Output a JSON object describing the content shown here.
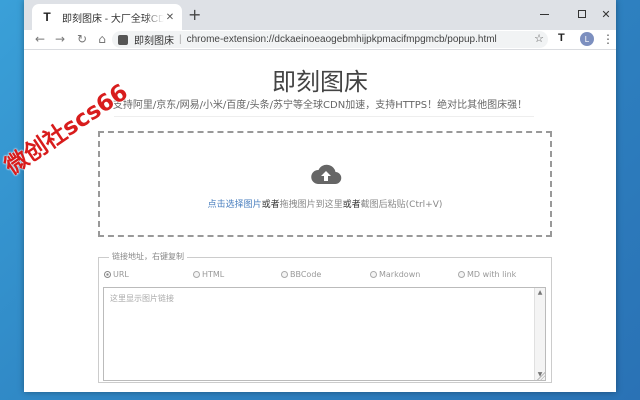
{
  "browser": {
    "tab_favicon": "T",
    "tab_title": "即刻图床 - 大厂全球CDN加速",
    "tab_close": "✕",
    "new_tab": "+",
    "window_controls": {
      "close": "✕"
    },
    "nav": {
      "back": "←",
      "forward": "→",
      "reload": "↻",
      "home": "⌂"
    },
    "omnibox": {
      "site": "即刻图床",
      "separator": "|",
      "url": "chrome-extension://dckaeinoeaogebmhijpkpmacifmpgmcb/popup.html",
      "star": "☆"
    },
    "toolbar_ext": "T",
    "profile_initial": "L",
    "menu": "⋮"
  },
  "page": {
    "title": "即刻图床",
    "subtitle": "支持阿里/京东/网易/小米/百度/头条/苏宁等全球CDN加速，支持HTTPS！绝对比其他图床强！",
    "dropzone": {
      "icon": "cloud-upload-icon",
      "link_text": "点击选择图片",
      "or1": "或者",
      "drag_text": "拖拽图片到这里",
      "or2": "或者",
      "paste_text": "截图后粘贴(Ctrl+V)"
    },
    "links": {
      "legend": "链接地址，右键复制",
      "formats": [
        "URL",
        "HTML",
        "BBCode",
        "Markdown",
        "MD with link"
      ],
      "selected": "URL",
      "placeholder": "这里显示图片链接"
    }
  },
  "watermark": "微创社scs66",
  "colors": {
    "accent_link": "#4a7fbf",
    "watermark": "#d81c1c",
    "background": "#2f86c4"
  }
}
